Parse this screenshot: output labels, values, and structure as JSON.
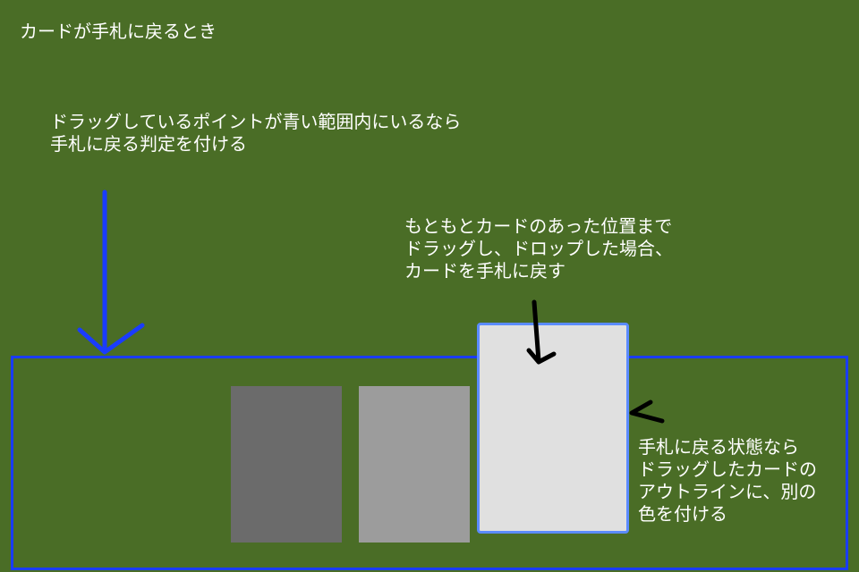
{
  "title": "カードが手札に戻るとき",
  "annotations": {
    "drop_zone": {
      "lines": [
        "ドラッグしているポイントが青い範囲内にいるなら",
        "手札に戻る判定を付ける"
      ]
    },
    "return_to_original": {
      "lines": [
        "もともとカードのあった位置まで",
        "ドラッグし、ドロップした場合、",
        "カードを手札に戻す"
      ]
    },
    "outline_color": {
      "lines": [
        "手札に戻る状態なら",
        "ドラッグしたカードの",
        "アウトラインに、別の",
        "色を付ける"
      ]
    }
  },
  "colors": {
    "background": "#4a6d26",
    "hand_area_border": "#1a3cff",
    "dragged_card_outline": "#5b8bff",
    "card_dark": "#6b6b6b",
    "card_mid": "#9c9c9c",
    "card_light": "#e0e0e0",
    "arrow_blue": "#1a3cff",
    "arrow_black": "#000000"
  },
  "icons": [
    "down-arrow-icon",
    "pointer-arrow-icon"
  ]
}
